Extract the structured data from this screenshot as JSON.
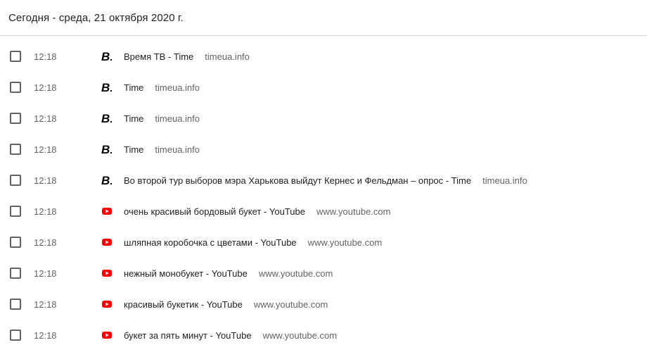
{
  "header": {
    "date": "Сегодня - среда, 21 октября 2020 г."
  },
  "entries": [
    {
      "time": "12:18",
      "icon": "timeua-icon",
      "title": "Время ТВ - Time",
      "domain": "timeua.info"
    },
    {
      "time": "12:18",
      "icon": "timeua-icon",
      "title": "Time",
      "domain": "timeua.info"
    },
    {
      "time": "12:18",
      "icon": "timeua-icon",
      "title": "Time",
      "domain": "timeua.info"
    },
    {
      "time": "12:18",
      "icon": "timeua-icon",
      "title": "Time",
      "domain": "timeua.info"
    },
    {
      "time": "12:18",
      "icon": "timeua-icon",
      "title": "Во второй тур выборов мэра Харькова выйдут Кернес и Фельдман – опрос - Time",
      "domain": "timeua.info"
    },
    {
      "time": "12:18",
      "icon": "youtube-icon",
      "title": "очень красивый бордовый букет - YouTube",
      "domain": "www.youtube.com"
    },
    {
      "time": "12:18",
      "icon": "youtube-icon",
      "title": "шляпная коробочка с цветами - YouTube",
      "domain": "www.youtube.com"
    },
    {
      "time": "12:18",
      "icon": "youtube-icon",
      "title": "нежный монобукет - YouTube",
      "domain": "www.youtube.com"
    },
    {
      "time": "12:18",
      "icon": "youtube-icon",
      "title": "красивый букетик - YouTube",
      "domain": "www.youtube.com"
    },
    {
      "time": "12:18",
      "icon": "youtube-icon",
      "title": "букет за пять минут - YouTube",
      "domain": "www.youtube.com"
    }
  ],
  "colors": {
    "youtube_red": "#ff0000",
    "timeua_black": "#000000"
  }
}
